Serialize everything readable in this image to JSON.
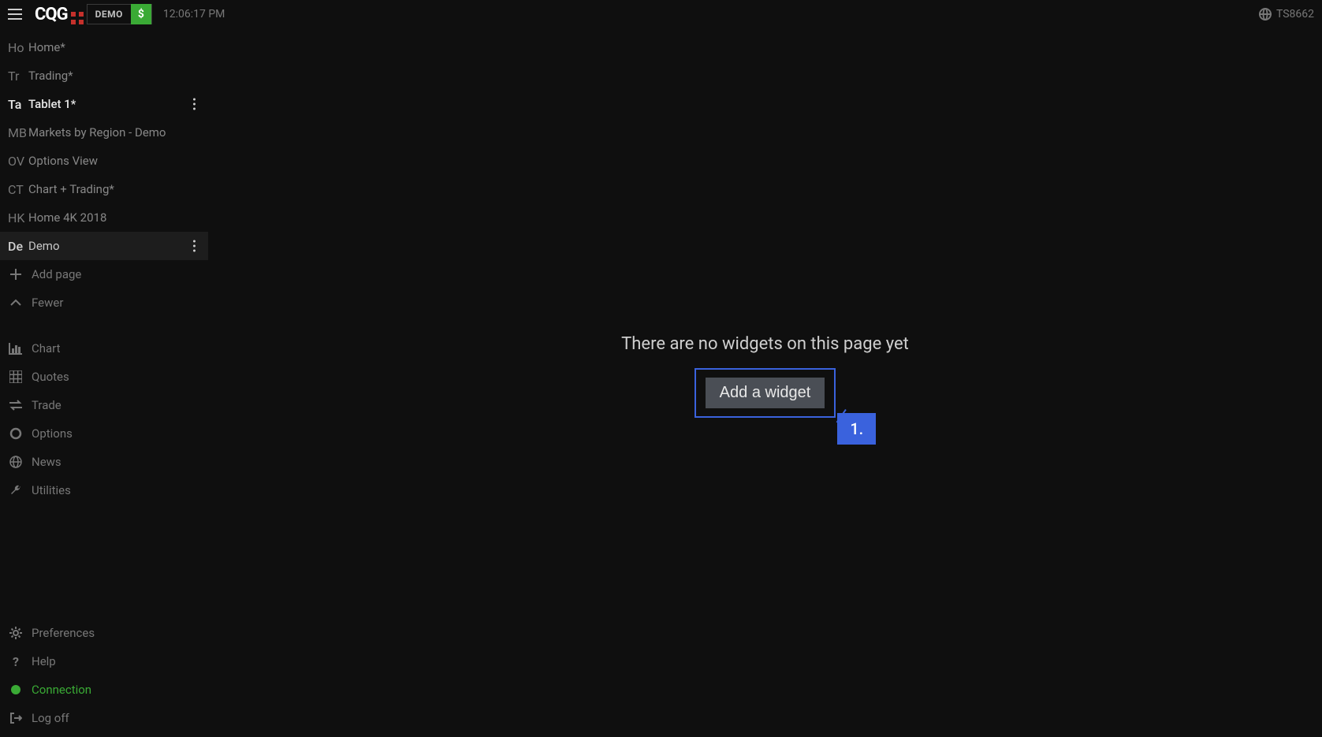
{
  "header": {
    "logo_text": "CQG",
    "badge_text": "DEMO",
    "badge_symbol": "$",
    "clock": "12:06:17 PM",
    "account": "TS8662"
  },
  "sidebar": {
    "pages": [
      {
        "abbrev": "Ho",
        "label": "Home*",
        "active": false
      },
      {
        "abbrev": "Tr",
        "label": "Trading*",
        "active": false
      },
      {
        "abbrev": "Ta",
        "label": "Tablet 1*",
        "active": true,
        "menu": true
      },
      {
        "abbrev": "MB",
        "label": "Markets by Region - Demo",
        "active": false
      },
      {
        "abbrev": "OV",
        "label": "Options View",
        "active": false
      },
      {
        "abbrev": "CT",
        "label": "Chart + Trading*",
        "active": false
      },
      {
        "abbrev": "HK",
        "label": "Home 4K 2018",
        "active": false
      },
      {
        "abbrev": "De",
        "label": "Demo",
        "active": false,
        "hovered": true,
        "menu": true
      }
    ],
    "add_page_label": "Add page",
    "fewer_label": "Fewer",
    "tools": [
      {
        "icon": "chart-icon",
        "label": "Chart"
      },
      {
        "icon": "grid-icon",
        "label": "Quotes"
      },
      {
        "icon": "trade-icon",
        "label": "Trade"
      },
      {
        "icon": "circle-icon",
        "label": "Options"
      },
      {
        "icon": "globe-icon",
        "label": "News"
      },
      {
        "icon": "wrench-icon",
        "label": "Utilities"
      }
    ],
    "bottom": {
      "preferences": "Preferences",
      "help": "Help",
      "connection": "Connection",
      "logoff": "Log off"
    }
  },
  "main": {
    "empty_title": "There are no widgets on this page yet",
    "add_widget_label": "Add a widget",
    "callout_label": "1."
  }
}
